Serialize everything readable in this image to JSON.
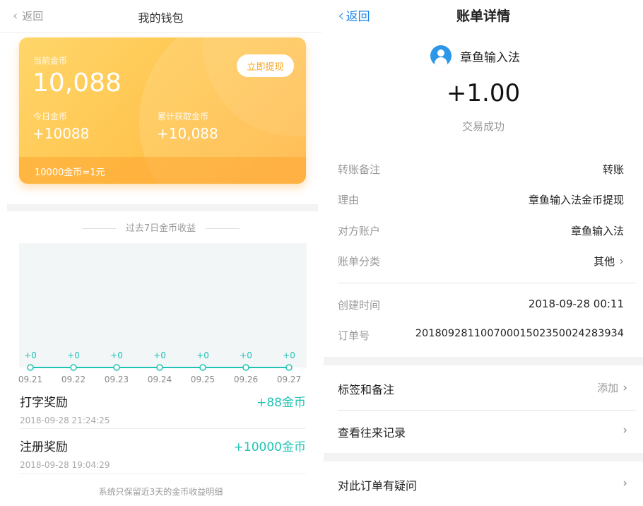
{
  "left": {
    "nav": {
      "back_label": "返回",
      "title": "我的钱包"
    },
    "card": {
      "current_coins_label": "当前金币",
      "current_coins": "10,088",
      "withdraw_button": "立即提现",
      "today_label": "今日金币",
      "today_value": "+10088",
      "total_label": "累计获取金币",
      "total_value": "+10,088",
      "rate_text": "10000金币=1元",
      "colors": {
        "gradient_start": "#ffd66a",
        "gradient_end": "#ffb541",
        "withdraw_text": "#f4a52a"
      }
    },
    "chart_title": "过去7日金币收益",
    "chart_data": {
      "type": "line",
      "categories": [
        "09.21",
        "09.22",
        "09.23",
        "09.24",
        "09.25",
        "09.26",
        "09.27"
      ],
      "values": [
        0,
        0,
        0,
        0,
        0,
        0,
        0
      ],
      "data_labels": [
        "+0",
        "+0",
        "+0",
        "+0",
        "+0",
        "+0",
        "+0"
      ],
      "title": "过去7日金币收益",
      "line_color": "#21c3b5",
      "grid": false
    },
    "records": [
      {
        "title": "打字奖励",
        "time": "2018-09-28 21:24:25",
        "amount": "+88金币"
      },
      {
        "title": "注册奖励",
        "time": "2018-09-28 19:04:29",
        "amount": "+10000金币"
      }
    ],
    "accent_color": "#21c3b5",
    "footer_note": "系统只保留近3天的金币收益明细"
  },
  "right": {
    "nav": {
      "back_label": "返回",
      "title": "账单详情"
    },
    "payee": "章鱼输入法",
    "amount": "+1.00",
    "status": "交易成功",
    "details": [
      {
        "key": "转账备注",
        "value": "转账"
      },
      {
        "key": "理由",
        "value": "章鱼输入法金币提现"
      },
      {
        "key": "对方账户",
        "value": "章鱼输入法"
      },
      {
        "key": "账单分类",
        "value": "其他"
      }
    ],
    "meta": [
      {
        "key": "创建时间",
        "value": "2018-09-28 00:11"
      },
      {
        "key": "订单号",
        "value": "20180928110070001502350024283934"
      }
    ],
    "actions": [
      {
        "label": "标签和备注",
        "value": "添加"
      },
      {
        "label": "查看往来记录",
        "value": ""
      },
      {
        "label": "对此订单有疑问",
        "value": ""
      }
    ],
    "accent_color": "#1a85e8"
  }
}
